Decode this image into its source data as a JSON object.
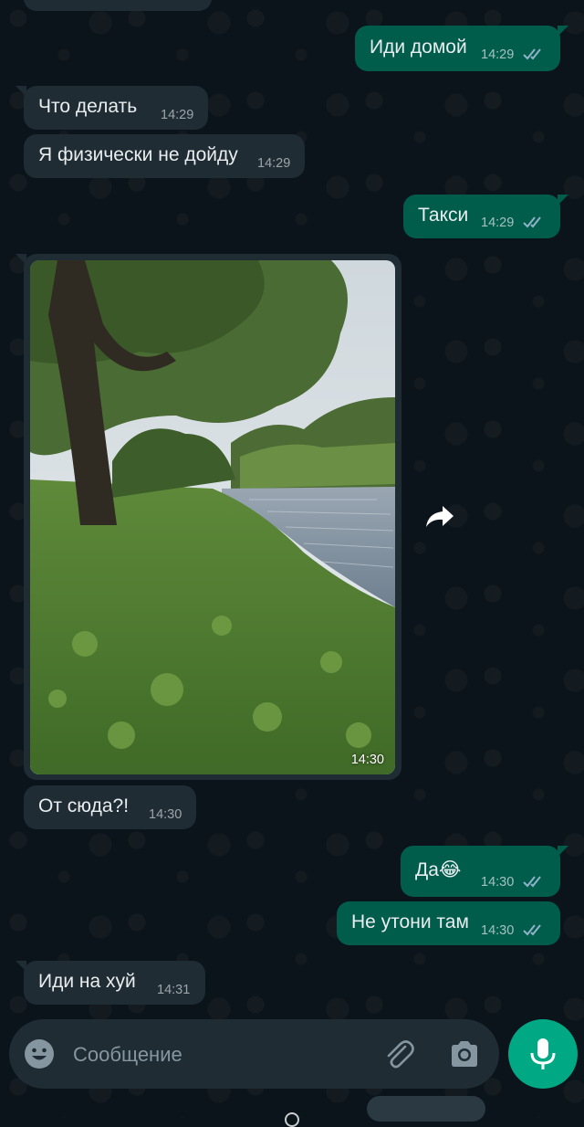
{
  "messages": [
    {
      "dir": "out",
      "text": "Иди домой",
      "time": "14:29",
      "read": true
    },
    {
      "dir": "in",
      "text": "Что делать",
      "time": "14:29"
    },
    {
      "dir": "in",
      "text": "Я физически не дойду",
      "time": "14:29"
    },
    {
      "dir": "out",
      "text": "Такси",
      "time": "14:29",
      "read": true
    },
    {
      "dir": "in",
      "type": "photo",
      "time": "14:30"
    },
    {
      "dir": "in",
      "text": "От сюда?!",
      "time": "14:30"
    },
    {
      "dir": "out",
      "text": "Да😂",
      "time": "14:30",
      "read": true
    },
    {
      "dir": "out",
      "text": "Не утони там",
      "time": "14:30",
      "read": true
    },
    {
      "dir": "in",
      "text": "Иди на хуй",
      "time": "14:31"
    }
  ],
  "composer": {
    "placeholder": "Сообщение",
    "icons": [
      "emoji-icon",
      "attach-icon",
      "camera-icon"
    ],
    "send_icon": "mic-icon"
  },
  "colors": {
    "background": "#0b141a",
    "incoming": "#1f2c34",
    "outgoing": "#005c4b",
    "accent": "#00a884",
    "read_ticks": "#8fb3c8"
  }
}
